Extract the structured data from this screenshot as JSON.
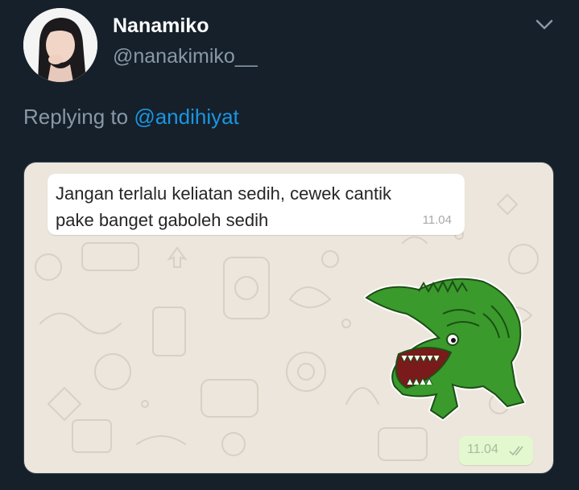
{
  "author": {
    "display_name": "Nanamiko",
    "handle": "@nanakimiko__"
  },
  "reply": {
    "prefix": "Replying to",
    "mention": "@andihiyat"
  },
  "chat": {
    "incoming_message": "Jangan terlalu keliatan sedih, cewek cantik pake banget gaboleh sedih",
    "incoming_time": "11.04",
    "outgoing_time": "11.04",
    "sticker": "crocodile-sticker",
    "outgoing_status_icon": "double-check-icon"
  },
  "colors": {
    "background": "#15202b",
    "link": "#1b95e0",
    "chat_wallpaper": "#ede6dc",
    "outgoing_bubble": "#e4f8cf",
    "sticker_green": "#3a9a2c"
  }
}
